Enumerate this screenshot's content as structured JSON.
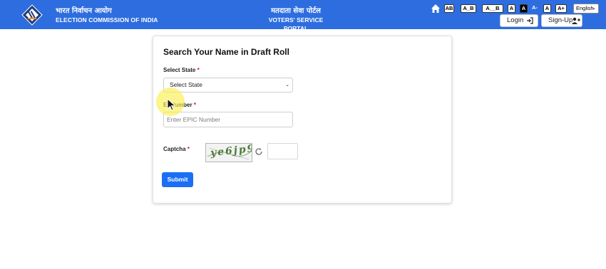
{
  "header": {
    "org_hindi": "भारत निर्वाचन आयोग",
    "org_english": "ELECTION COMMISSION OF INDIA",
    "portal_hindi": "मतदाता सेवा पोर्टल",
    "portal_english": "VOTERS' SERVICE PORTAL",
    "accessibility": [
      "AB",
      "A_B",
      "A__B",
      "A",
      "A",
      "A-",
      "A",
      "A+"
    ],
    "language": "English",
    "login_label": "Login",
    "signup_label": "Sign-Up",
    "bg_color": "#2d6ddf"
  },
  "form": {
    "title": "Search Your Name in Draft Roll",
    "state_label": "Select State",
    "state_value": "Select State",
    "epic_label": "Number",
    "epic_label_prefix": "E",
    "epic_placeholder": "Enter EPIC Number",
    "captcha_label": "Captcha",
    "captcha_text": "ye6jp9",
    "required_mark": "*",
    "submit_label": "Submit",
    "accent_color": "#1b6ff5"
  },
  "icons": [
    "eci-logo-icon",
    "home-icon",
    "login-arrow-icon",
    "add-user-icon",
    "refresh-icon",
    "chevron-down-icon",
    "cursor-icon"
  ]
}
